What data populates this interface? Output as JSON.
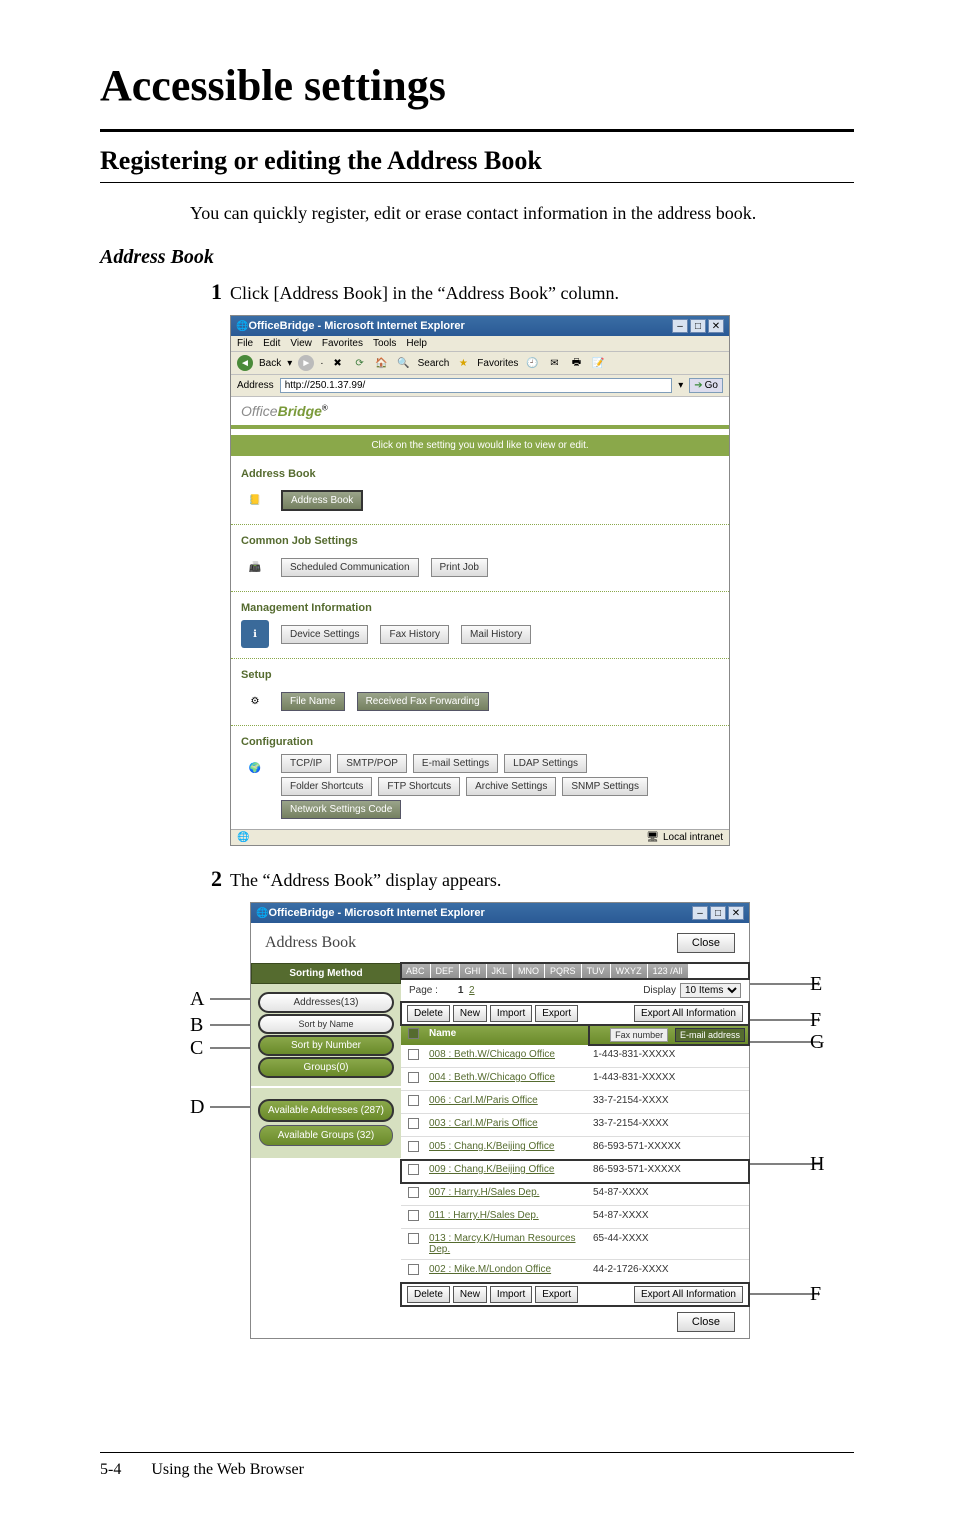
{
  "title": "Accessible settings",
  "subtitle": "Registering or editing the Address Book",
  "intro": "You can quickly register, edit or erase contact information in the address book.",
  "section_head": "Address Book",
  "step1": {
    "num": "1",
    "text": "Click [Address Book] in the “Address Book” column."
  },
  "step2": {
    "num": "2",
    "text": "The “Address Book” display appears."
  },
  "ie": {
    "title": "OfficeBridge - Microsoft Internet Explorer",
    "menus": [
      "File",
      "Edit",
      "View",
      "Favorites",
      "Tools",
      "Help"
    ],
    "back": "Back",
    "search": "Search",
    "favorites": "Favorites",
    "addr_label": "Address",
    "addr_value": "http://250.1.37.99/",
    "go": "Go",
    "zone": "Local intranet",
    "winbtns": [
      "–",
      "□",
      "✕"
    ]
  },
  "logo": {
    "a": "Office",
    "b": "Bridge"
  },
  "banner": "Click on the setting you would like to view or edit.",
  "panel": {
    "address_book": {
      "title": "Address Book",
      "btn": "Address Book"
    },
    "common": {
      "title": "Common Job Settings",
      "b1": "Scheduled Communication",
      "b2": "Print Job"
    },
    "mgmt": {
      "title": "Management Information",
      "b1": "Device Settings",
      "b2": "Fax History",
      "b3": "Mail History"
    },
    "setup": {
      "title": "Setup",
      "b1": "File Name",
      "b2": "Received Fax Forwarding"
    },
    "config": {
      "title": "Configuration",
      "r1": [
        "TCP/IP",
        "SMTP/POP",
        "E-mail Settings",
        "LDAP Settings"
      ],
      "r2": [
        "Folder Shortcuts",
        "FTP Shortcuts",
        "Archive Settings",
        "SNMP Settings"
      ],
      "r3": "Network Settings Code"
    }
  },
  "ab": {
    "heading": "Address Book",
    "close": "Close",
    "sort_head": "Sorting Method",
    "addresses": "Addresses(13)",
    "sort_name": "Sort by Name",
    "sort_num": "Sort by Number",
    "groups": "Groups(0)",
    "avail_addr": "Available Addresses (287)",
    "avail_grp": "Available Groups (32)",
    "alpha_tabs": [
      "ABC",
      "DEF",
      "GHI",
      "JKL",
      "MNO",
      "PQRS",
      "TUV",
      "WXYZ",
      "123 /All"
    ],
    "page_label": "Page :",
    "page_nums": "1  2",
    "display_label": "Display",
    "display_val": "10 Items",
    "tbtns": [
      "Delete",
      "New",
      "Import",
      "Export"
    ],
    "exportall": "Export All Information",
    "col_name": "Name",
    "sort_fax": "Fax number",
    "sort_email": "E-mail address",
    "rows": [
      {
        "name": "008 : Beth.W/Chicago Office",
        "val": "1-443-831-XXXXX"
      },
      {
        "name": "004 : Beth.W/Chicago Office",
        "val": "1-443-831-XXXXX"
      },
      {
        "name": "006 : Carl.M/Paris Office",
        "val": "33-7-2154-XXXX"
      },
      {
        "name": "003 : Carl.M/Paris Office",
        "val": "33-7-2154-XXXX"
      },
      {
        "name": "005 : Chang.K/Beijing Office",
        "val": "86-593-571-XXXXX"
      },
      {
        "name": "009 : Chang.K/Beijing Office",
        "val": "86-593-571-XXXXX"
      },
      {
        "name": "007 : Harry.H/Sales Dep.",
        "val": "54-87-XXXX"
      },
      {
        "name": "011 : Harry.H/Sales Dep.",
        "val": "54-87-XXXX"
      },
      {
        "name": "013 : Marcy.K/Human Resources Dep.",
        "val": "65-44-XXXX"
      },
      {
        "name": "002 : Mike.M/London Office",
        "val": "44-2-1726-XXXX"
      }
    ]
  },
  "callouts": {
    "A": "A",
    "B": "B",
    "C": "C",
    "D": "D",
    "E": "E",
    "F": "F",
    "G": "G",
    "H": "H"
  },
  "footer": {
    "page": "5-4",
    "chapter": "Using the Web Browser"
  }
}
